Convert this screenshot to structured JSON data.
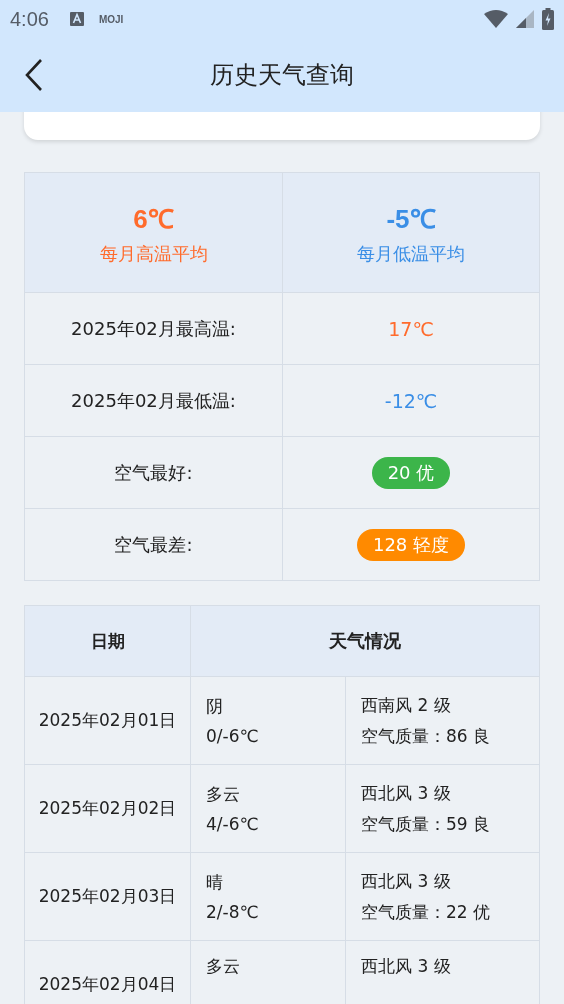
{
  "status_bar": {
    "time": "4:06",
    "app_label": "MOJI"
  },
  "header": {
    "title": "历史天气查询"
  },
  "summary": {
    "high_avg": {
      "value": "6℃",
      "label": "每月高温平均"
    },
    "low_avg": {
      "value": "-5℃",
      "label": "每月低温平均"
    },
    "rows": [
      {
        "kind": "high",
        "label": "2025年02月最高温:",
        "value": "17℃"
      },
      {
        "kind": "low",
        "label": "2025年02月最低温:",
        "value": "-12℃"
      },
      {
        "kind": "badge",
        "label": "空气最好:",
        "value": "20 优",
        "color": "#3cb54a"
      },
      {
        "kind": "badge",
        "label": "空气最差:",
        "value": "128 轻度",
        "color": "#ff8a00"
      }
    ]
  },
  "history": {
    "columns": [
      "日期",
      "天气情况"
    ],
    "rows": [
      {
        "date": "2025年02月01日",
        "weather": "阴",
        "temp": "0/-6℃",
        "wind": "西南风 2 级",
        "air": "空气质量：86 良"
      },
      {
        "date": "2025年02月02日",
        "weather": "多云",
        "temp": "4/-6℃",
        "wind": "西北风 3 级",
        "air": "空气质量：59 良"
      },
      {
        "date": "2025年02月03日",
        "weather": "晴",
        "temp": "2/-8℃",
        "wind": "西北风 3 级",
        "air": "空气质量：22 优"
      },
      {
        "date": "2025年02月04日",
        "weather": "多云",
        "wind": "西北风 3 级"
      }
    ]
  }
}
